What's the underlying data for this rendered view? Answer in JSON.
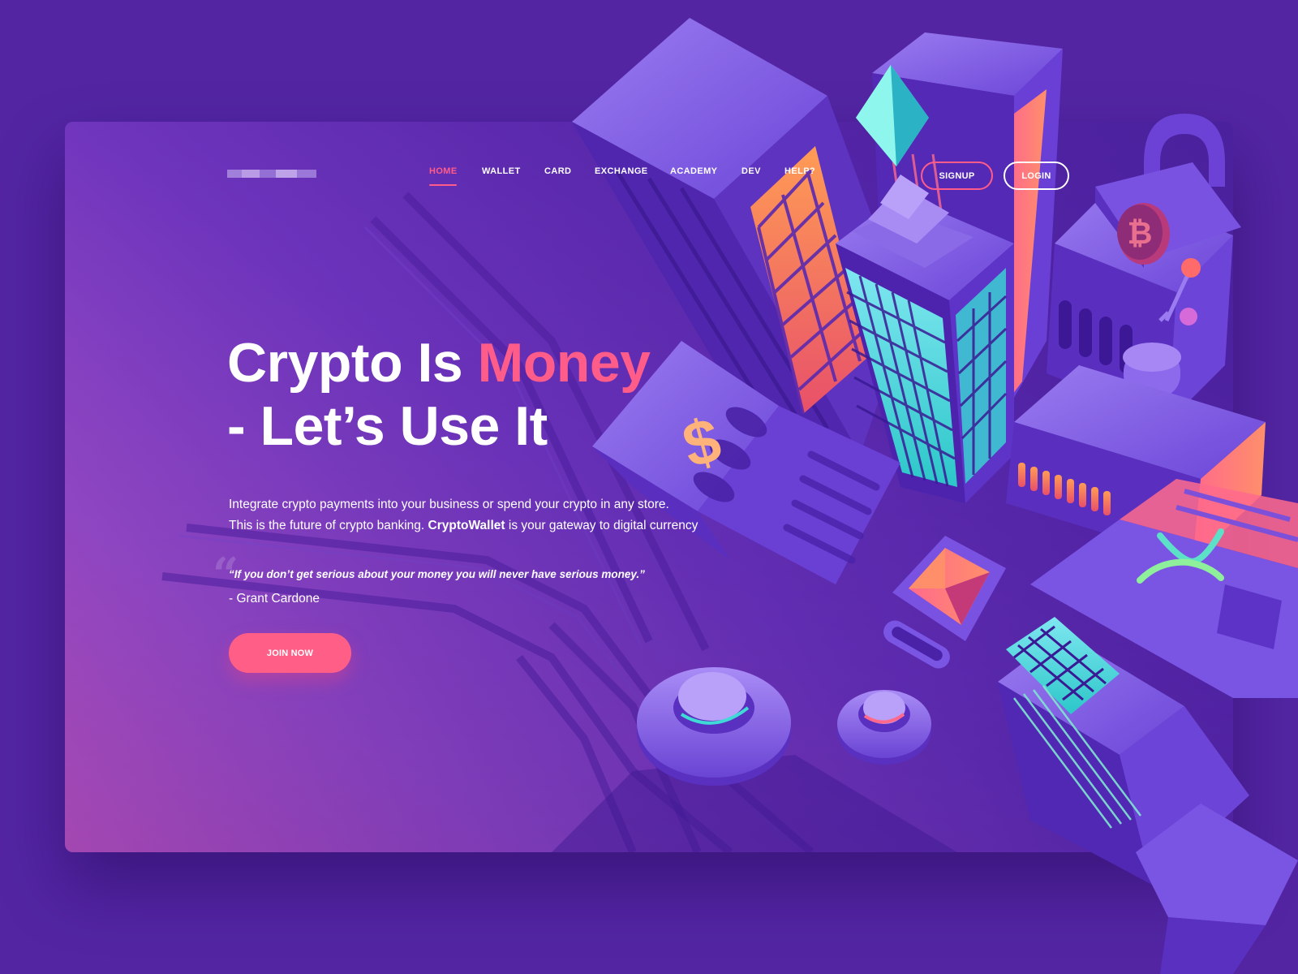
{
  "colors": {
    "background": "#5325a3",
    "accent_pink": "#ff5c8a",
    "text": "#ffffff",
    "card_gradient": [
      "#c556b8",
      "#9a4cc6",
      "#6f35bd",
      "#5526a8",
      "#4b219c"
    ],
    "building_cyan": "#3fd9d6",
    "building_orange": "#f5935a"
  },
  "header": {
    "logo": "",
    "nav": [
      {
        "label": "HOME",
        "active": true
      },
      {
        "label": "WALLET"
      },
      {
        "label": "CARD"
      },
      {
        "label": "EXCHANGE"
      },
      {
        "label": "ACADEMY"
      },
      {
        "label": "DEV"
      },
      {
        "label": "HELP?"
      }
    ],
    "signup_label": "SIGNUP",
    "login_label": "LOGIN"
  },
  "hero": {
    "title_part1": "Crypto Is ",
    "title_accent": "Money",
    "title_line2": "- Let’s Use It",
    "description_line1": "Integrate crypto payments into your business or spend your crypto in any store.",
    "description_line2_prefix": "This is the future of crypto banking. ",
    "description_brand": "CryptoWallet",
    "description_line2_suffix": " is your gateway to digital currency",
    "quote_mark": "“",
    "quote": "“If you don’t get serious about your money you will never have serious money.”",
    "quote_author": "- Grant Cardone",
    "cta_label": "JOIN NOW"
  },
  "illustration": {
    "icons": [
      "ethereum-crystal-icon",
      "bitcoin-coin-icon",
      "dollar-sign-icon",
      "ripple-x-icon",
      "padlock-icon"
    ]
  }
}
